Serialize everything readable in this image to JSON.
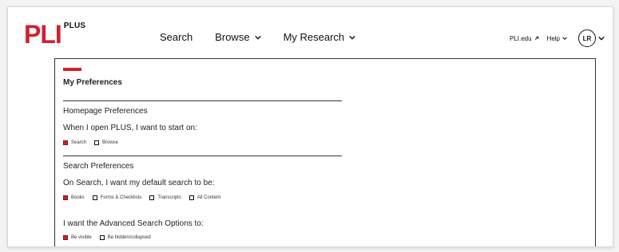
{
  "header": {
    "logo_text": "PLI",
    "logo_sup": "PLUS",
    "nav": [
      {
        "label": "Search",
        "has_chevron": false
      },
      {
        "label": "Browse",
        "has_chevron": true
      },
      {
        "label": "My Research",
        "has_chevron": true
      }
    ],
    "right": {
      "pli_edu": "PLI.edu",
      "pli_edu_icon": "external-link-icon",
      "help": "Help",
      "avatar_initials": "LR"
    }
  },
  "preferences": {
    "title": "My Preferences",
    "homepage": {
      "heading": "Homepage Preferences",
      "question": "When I open PLUS, I want to start on:",
      "options": [
        {
          "label": "Search",
          "checked": true
        },
        {
          "label": "Browse",
          "checked": false
        }
      ]
    },
    "search": {
      "heading": "Search Preferences",
      "question": "On Search, I want my default search to be:",
      "options": [
        {
          "label": "Books",
          "checked": true
        },
        {
          "label": "Forms & Checklists",
          "checked": false
        },
        {
          "label": "Transcripts",
          "checked": false
        },
        {
          "label": "All Content",
          "checked": false
        }
      ],
      "advanced_question": "I want the Advanced Search Options to:",
      "advanced_options": [
        {
          "label": "Be visible",
          "checked": true
        },
        {
          "label": "Be hidden/collapsed",
          "checked": false
        }
      ]
    }
  },
  "colors": {
    "brand_red": "#d0212f",
    "text": "#222222"
  }
}
